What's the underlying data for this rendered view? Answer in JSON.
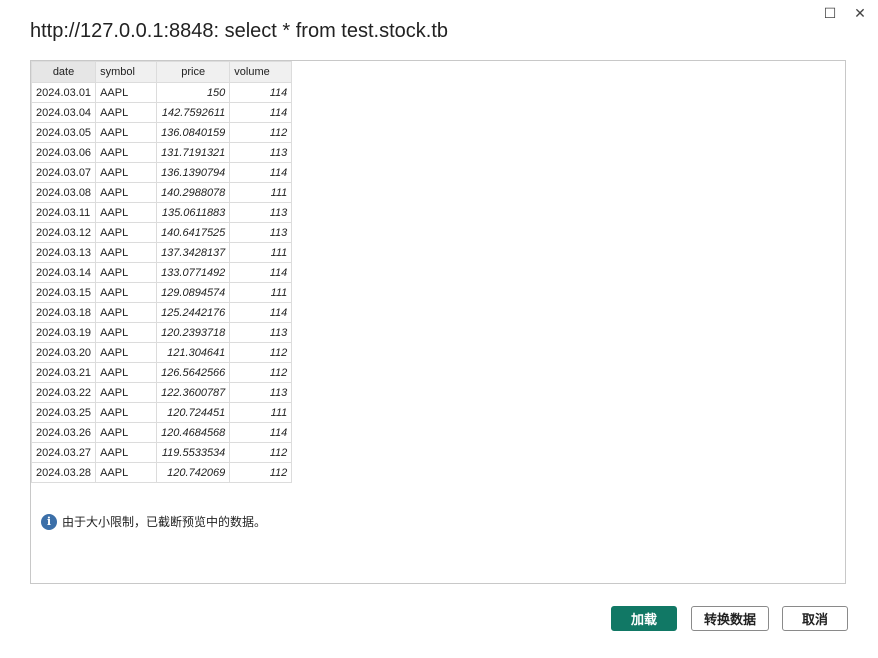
{
  "window": {
    "maximize_glyph": "☐",
    "close_glyph": "✕"
  },
  "title": "http://127.0.0.1:8848: select * from test.stock.tb",
  "table": {
    "columns": [
      "date",
      "symbol",
      "price",
      "volume"
    ],
    "rows": [
      [
        "2024.03.01",
        "AAPL",
        "150",
        "114"
      ],
      [
        "2024.03.04",
        "AAPL",
        "142.7592611",
        "114"
      ],
      [
        "2024.03.05",
        "AAPL",
        "136.0840159",
        "112"
      ],
      [
        "2024.03.06",
        "AAPL",
        "131.7191321",
        "113"
      ],
      [
        "2024.03.07",
        "AAPL",
        "136.1390794",
        "114"
      ],
      [
        "2024.03.08",
        "AAPL",
        "140.2988078",
        "111"
      ],
      [
        "2024.03.11",
        "AAPL",
        "135.0611883",
        "113"
      ],
      [
        "2024.03.12",
        "AAPL",
        "140.6417525",
        "113"
      ],
      [
        "2024.03.13",
        "AAPL",
        "137.3428137",
        "111"
      ],
      [
        "2024.03.14",
        "AAPL",
        "133.0771492",
        "114"
      ],
      [
        "2024.03.15",
        "AAPL",
        "129.0894574",
        "111"
      ],
      [
        "2024.03.18",
        "AAPL",
        "125.2442176",
        "114"
      ],
      [
        "2024.03.19",
        "AAPL",
        "120.2393718",
        "113"
      ],
      [
        "2024.03.20",
        "AAPL",
        "121.304641",
        "112"
      ],
      [
        "2024.03.21",
        "AAPL",
        "126.5642566",
        "112"
      ],
      [
        "2024.03.22",
        "AAPL",
        "122.3600787",
        "113"
      ],
      [
        "2024.03.25",
        "AAPL",
        "120.724451",
        "111"
      ],
      [
        "2024.03.26",
        "AAPL",
        "120.4684568",
        "114"
      ],
      [
        "2024.03.27",
        "AAPL",
        "119.5533534",
        "112"
      ],
      [
        "2024.03.28",
        "AAPL",
        "120.742069",
        "112"
      ]
    ]
  },
  "notice": {
    "icon": "info-icon",
    "icon_glyph": "i",
    "text": "由于大小限制，已截断预览中的数据。"
  },
  "buttons": {
    "load": "加载",
    "transform": "转换数据",
    "cancel": "取消"
  },
  "colors": {
    "primary": "#117865",
    "info": "#3b6fa8"
  }
}
